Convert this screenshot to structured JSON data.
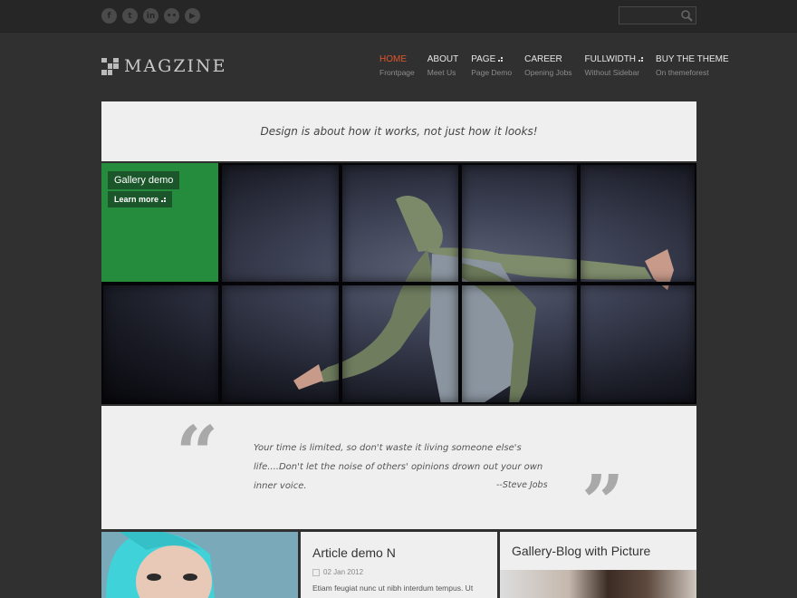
{
  "topbar": {
    "social": [
      {
        "name": "facebook-icon",
        "glyph": "f"
      },
      {
        "name": "twitter-icon",
        "glyph": "t"
      },
      {
        "name": "linkedin-icon",
        "glyph": "in"
      },
      {
        "name": "flickr-icon",
        "glyph": "••"
      },
      {
        "name": "youtube-icon",
        "glyph": "▶"
      }
    ],
    "search": {
      "placeholder": ""
    }
  },
  "logo": {
    "text": "MAGZINE"
  },
  "nav": [
    {
      "title": "HOME",
      "sub": "Frontpage",
      "active": true,
      "dropdown": false
    },
    {
      "title": "ABOUT",
      "sub": "Meet Us",
      "active": false,
      "dropdown": false
    },
    {
      "title": "PAGE",
      "sub": "Page Demo",
      "active": false,
      "dropdown": true
    },
    {
      "title": "CAREER",
      "sub": "Opening Jobs",
      "active": false,
      "dropdown": false
    },
    {
      "title": "FULLWIDTH",
      "sub": "Without Sidebar",
      "active": false,
      "dropdown": true
    },
    {
      "title": "BUY THE THEME",
      "sub": "On themeforest",
      "active": false,
      "dropdown": false
    }
  ],
  "tagline": "Design is about how it works, not just how it looks!",
  "slider": {
    "caption_title": "Gallery demo",
    "caption_more": "Learn more"
  },
  "quote": {
    "text": "Your time is limited, so don't waste it living someone else's life....Don't let the noise of others' opinions drown out your own inner voice.",
    "author": "--Steve Jobs"
  },
  "cards": {
    "article": {
      "title": "Article demo N",
      "date": "02 Jan 2012",
      "excerpt": "Etiam feugiat nunc ut nibh interdum tempus. Ut"
    },
    "gallery": {
      "title": "Gallery-Blog with Picture"
    }
  },
  "colors": {
    "accent": "#e0552c",
    "gallery_green": "#258c3e",
    "background": "#303030"
  }
}
